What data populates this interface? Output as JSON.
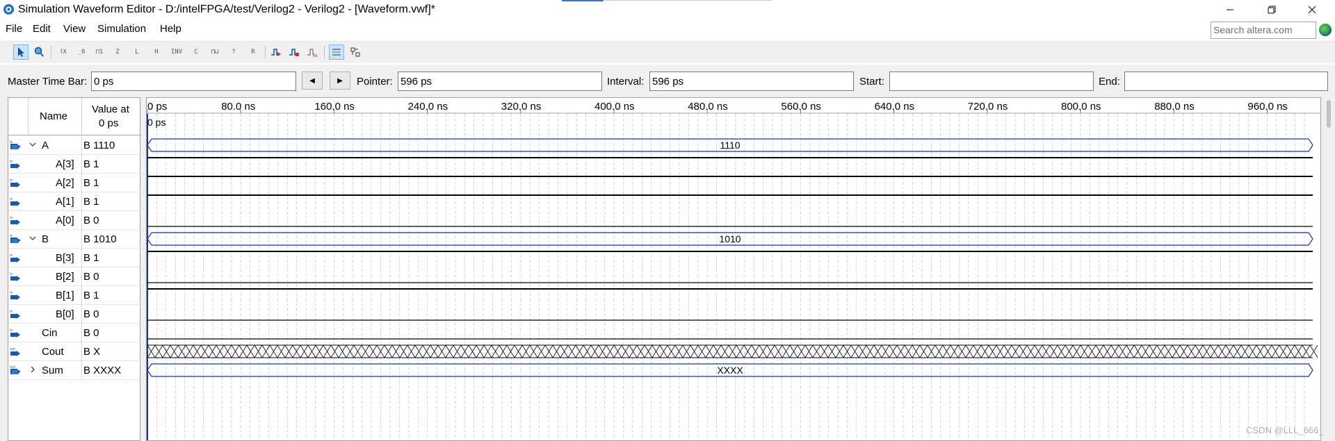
{
  "window": {
    "title": "Simulation Waveform Editor - D:/intelFPGA/test/Verilog2 - Verilog2 - [Waveform.vwf]*",
    "minimize_icon": "minimize-icon",
    "restore_icon": "restore-icon",
    "close_icon": "close-icon"
  },
  "menu": {
    "items": [
      "File",
      "Edit",
      "View",
      "Simulation",
      "Help"
    ],
    "search_placeholder": "Search altera.com"
  },
  "toolbar": {
    "icons": [
      "pointer-icon",
      "zoom-icon",
      "x-value-icon",
      "zero-value-icon",
      "one-value-icon",
      "high-impedance-icon",
      "weak-low-icon",
      "weak-high-icon",
      "invert-icon",
      "count-value-icon",
      "clock-value-icon",
      "arbitrary-value-icon",
      "random-value-icon",
      "snap-to-grid-icon",
      "overwrite-clock-icon",
      "run-functional-simulation-icon",
      "run-timing-simulation-icon",
      "generate-netlist-icon",
      "grid-icon",
      "settings-icon"
    ]
  },
  "timebar": {
    "master_label": "Master Time Bar:",
    "master_value": "0 ps",
    "pointer_label": "Pointer:",
    "pointer_value": "596 ps",
    "interval_label": "Interval:",
    "interval_value": "596 ps",
    "start_label": "Start:",
    "start_value": "",
    "end_label": "End:",
    "end_value": ""
  },
  "table": {
    "name_header": "Name",
    "value_header_line1": "Value at",
    "value_header_line2": "0 ps",
    "signals": [
      {
        "name": "A",
        "value": "B 1110",
        "type": "in",
        "group": true,
        "expanded": true
      },
      {
        "name": "A[3]",
        "value": "B 1",
        "type": "in"
      },
      {
        "name": "A[2]",
        "value": "B 1",
        "type": "in"
      },
      {
        "name": "A[1]",
        "value": "B 1",
        "type": "in"
      },
      {
        "name": "A[0]",
        "value": "B 0",
        "type": "in"
      },
      {
        "name": "B",
        "value": "B 1010",
        "type": "in",
        "group": true,
        "expanded": true
      },
      {
        "name": "B[3]",
        "value": "B 1",
        "type": "in"
      },
      {
        "name": "B[2]",
        "value": "B 0",
        "type": "in"
      },
      {
        "name": "B[1]",
        "value": "B 1",
        "type": "in"
      },
      {
        "name": "B[0]",
        "value": "B 0",
        "type": "in"
      },
      {
        "name": "Cin",
        "value": "B 0",
        "type": "in"
      },
      {
        "name": "Cout",
        "value": "B X",
        "type": "out"
      },
      {
        "name": "Sum",
        "value": "B XXXX",
        "type": "out",
        "group": true,
        "expanded": false
      }
    ]
  },
  "waveform": {
    "ticks": [
      "0 ps",
      "80.0 ns",
      "160.0 ns",
      "240.0 ns",
      "320.0 ns",
      "400.0 ns",
      "480.0 ns",
      "560.0 ns",
      "640.0 ns",
      "720.0 ns",
      "800.0 ns",
      "880.0 ns",
      "960.0 ns"
    ],
    "cursor_label": "0 ps",
    "bus_labels": {
      "A": "1110",
      "B": "1010",
      "Sum": "XXXX"
    },
    "levels": {
      "A[3]": 1,
      "A[2]": 1,
      "A[1]": 1,
      "A[0]": 0,
      "B[3]": 1,
      "B[2]": 0,
      "B[1]": 1,
      "B[0]": 0,
      "Cin": 0,
      "Cout": "X"
    },
    "colors": {
      "bus": "#1f2fa8",
      "signal": "#000000",
      "grid": "#b8b8b8",
      "cursor": "#1f2fa8"
    }
  },
  "watermark": "CSDN @LLL_666_"
}
